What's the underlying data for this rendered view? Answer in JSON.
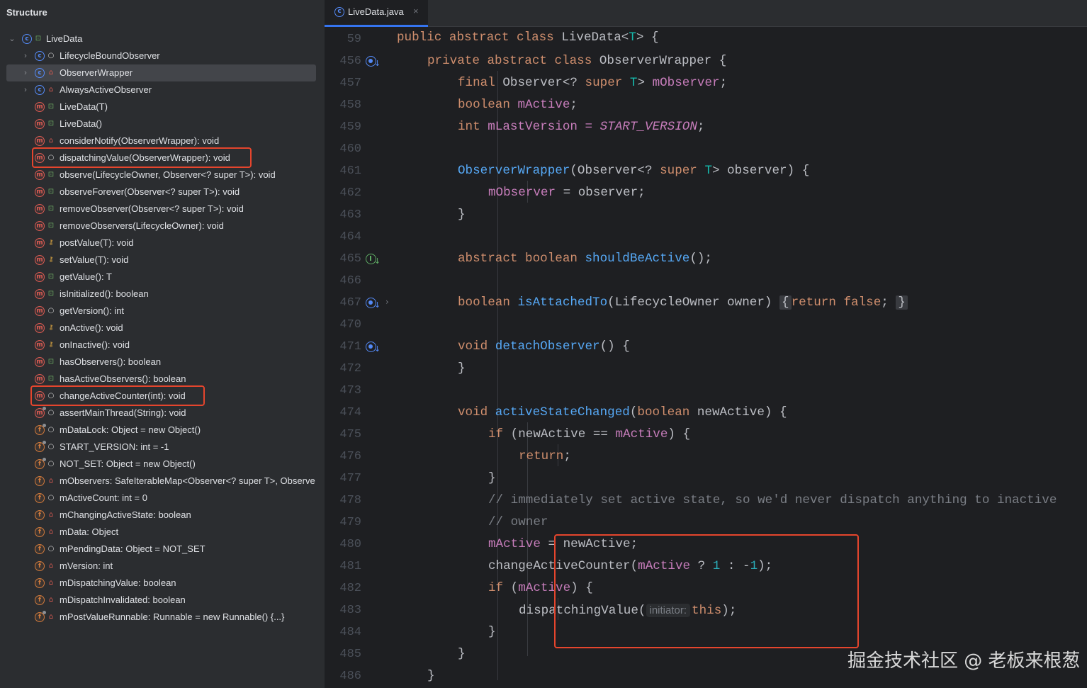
{
  "structure_panel": {
    "title": "Structure",
    "root": "LiveData",
    "items": [
      {
        "label": "LifecycleBoundObserver",
        "kind": "class",
        "vis": "package",
        "expandable": true
      },
      {
        "label": "ObserverWrapper",
        "kind": "class",
        "vis": "private",
        "expandable": true,
        "selected": true
      },
      {
        "label": "AlwaysActiveObserver",
        "kind": "class",
        "vis": "private",
        "expandable": true
      },
      {
        "label": "LiveData(T)",
        "kind": "method",
        "vis": "public"
      },
      {
        "label": "LiveData()",
        "kind": "method",
        "vis": "public"
      },
      {
        "label": "considerNotify(ObserverWrapper): void",
        "kind": "method",
        "vis": "private"
      },
      {
        "label": "dispatchingValue(ObserverWrapper): void",
        "kind": "method",
        "vis": "package",
        "highlighted": true
      },
      {
        "label": "observe(LifecycleOwner, Observer<? super T>): void",
        "kind": "method",
        "vis": "public"
      },
      {
        "label": "observeForever(Observer<? super T>): void",
        "kind": "method",
        "vis": "public"
      },
      {
        "label": "removeObserver(Observer<? super T>): void",
        "kind": "method",
        "vis": "public"
      },
      {
        "label": "removeObservers(LifecycleOwner): void",
        "kind": "method",
        "vis": "public"
      },
      {
        "label": "postValue(T): void",
        "kind": "method",
        "vis": "protected"
      },
      {
        "label": "setValue(T): void",
        "kind": "method",
        "vis": "protected"
      },
      {
        "label": "getValue(): T",
        "kind": "method",
        "vis": "public"
      },
      {
        "label": "isInitialized(): boolean",
        "kind": "method",
        "vis": "public"
      },
      {
        "label": "getVersion(): int",
        "kind": "method",
        "vis": "package"
      },
      {
        "label": "onActive(): void",
        "kind": "method",
        "vis": "protected"
      },
      {
        "label": "onInactive(): void",
        "kind": "method",
        "vis": "protected"
      },
      {
        "label": "hasObservers(): boolean",
        "kind": "method",
        "vis": "public"
      },
      {
        "label": "hasActiveObservers(): boolean",
        "kind": "method",
        "vis": "public"
      },
      {
        "label": "changeActiveCounter(int): void",
        "kind": "method",
        "vis": "package",
        "highlighted": true
      },
      {
        "label": "assertMainThread(String): void",
        "kind": "method",
        "vis": "package",
        "static": true
      },
      {
        "label": "mDataLock: Object = new Object()",
        "kind": "field",
        "vis": "package",
        "static": true
      },
      {
        "label": "START_VERSION: int = -1",
        "kind": "field",
        "vis": "package",
        "static": true
      },
      {
        "label": "NOT_SET: Object = new Object()",
        "kind": "field",
        "vis": "package",
        "static": true
      },
      {
        "label": "mObservers: SafeIterableMap<Observer<? super T>, Observe",
        "kind": "field",
        "vis": "private"
      },
      {
        "label": "mActiveCount: int = 0",
        "kind": "field",
        "vis": "package"
      },
      {
        "label": "mChangingActiveState: boolean",
        "kind": "field",
        "vis": "private"
      },
      {
        "label": "mData: Object",
        "kind": "field",
        "vis": "private"
      },
      {
        "label": "mPendingData: Object = NOT_SET",
        "kind": "field",
        "vis": "package"
      },
      {
        "label": "mVersion: int",
        "kind": "field",
        "vis": "private"
      },
      {
        "label": "mDispatchingValue: boolean",
        "kind": "field",
        "vis": "private"
      },
      {
        "label": "mDispatchInvalidated: boolean",
        "kind": "field",
        "vis": "private"
      },
      {
        "label": "mPostValueRunnable: Runnable = new Runnable() {...}",
        "kind": "field",
        "vis": "private",
        "static": true
      }
    ]
  },
  "editor": {
    "tab": {
      "label": "LiveData.java",
      "close": "×"
    },
    "lines": [
      {
        "no": "59",
        "gutter": null,
        "text": ""
      },
      {
        "no": "456",
        "gutter": "overridden",
        "text": ""
      },
      {
        "no": "457",
        "gutter": null,
        "text": ""
      },
      {
        "no": "458",
        "gutter": null,
        "text": ""
      },
      {
        "no": "459",
        "gutter": null,
        "text": ""
      },
      {
        "no": "460",
        "gutter": null,
        "text": ""
      },
      {
        "no": "461",
        "gutter": null,
        "text": ""
      },
      {
        "no": "462",
        "gutter": null,
        "text": ""
      },
      {
        "no": "463",
        "gutter": null,
        "text": ""
      },
      {
        "no": "464",
        "gutter": null,
        "text": ""
      },
      {
        "no": "465",
        "gutter": "implemented",
        "text": ""
      },
      {
        "no": "466",
        "gutter": null,
        "text": ""
      },
      {
        "no": "467",
        "gutter": "overridden",
        "text": ""
      },
      {
        "no": "470",
        "gutter": null,
        "text": ""
      },
      {
        "no": "471",
        "gutter": "overridden",
        "text": ""
      },
      {
        "no": "472",
        "gutter": null,
        "text": ""
      },
      {
        "no": "473",
        "gutter": null,
        "text": ""
      },
      {
        "no": "474",
        "gutter": null,
        "text": ""
      },
      {
        "no": "475",
        "gutter": null,
        "text": ""
      },
      {
        "no": "476",
        "gutter": null,
        "text": ""
      },
      {
        "no": "477",
        "gutter": null,
        "text": ""
      },
      {
        "no": "478",
        "gutter": null,
        "text": ""
      },
      {
        "no": "479",
        "gutter": null,
        "text": ""
      },
      {
        "no": "480",
        "gutter": null,
        "text": ""
      },
      {
        "no": "481",
        "gutter": null,
        "text": ""
      },
      {
        "no": "482",
        "gutter": null,
        "text": ""
      },
      {
        "no": "483",
        "gutter": null,
        "text": ""
      },
      {
        "no": "484",
        "gutter": null,
        "text": ""
      },
      {
        "no": "485",
        "gutter": null,
        "text": ""
      },
      {
        "no": "486",
        "gutter": null,
        "text": ""
      }
    ],
    "code": {
      "l59": [
        "public",
        "abstract",
        "class",
        "LiveData<",
        "T",
        "> {"
      ],
      "l456": [
        "private",
        "abstract",
        "class",
        "ObserverWrapper {"
      ],
      "l457": [
        "final",
        "Observer<?",
        "super",
        "T",
        ">",
        "mObserver",
        ";"
      ],
      "l458": [
        "boolean",
        "mActive",
        ";"
      ],
      "l459": [
        "int",
        "mLastVersion = ",
        "START_VERSION",
        ";"
      ],
      "l461": [
        "ObserverWrapper",
        "(Observer<?",
        "super",
        "T",
        "> observer) {"
      ],
      "l462": [
        "mObserver",
        " = observer;"
      ],
      "l463": "}",
      "l465": [
        "abstract",
        "boolean",
        "shouldBeActive",
        "();"
      ],
      "l467": [
        "boolean",
        "isAttachedTo",
        "(LifecycleOwner owner)",
        "{",
        "return",
        "false",
        ";",
        "}"
      ],
      "l471": [
        "void",
        "detachObserver",
        "() {"
      ],
      "l472": "}",
      "l474": [
        "void",
        "activeStateChanged",
        "(",
        "boolean",
        " newActive) {"
      ],
      "l475": [
        "if",
        " (newActive == ",
        "mActive",
        ") {"
      ],
      "l476": [
        "return",
        ";"
      ],
      "l477": "}",
      "l478": "// immediately set active state, so we'd never dispatch anything to inactive",
      "l479": "// owner",
      "l480": [
        "mActive",
        " = newActive;"
      ],
      "l481": [
        "changeActiveCounter(",
        "mActive",
        " ? ",
        "1",
        " : -",
        "1",
        ");"
      ],
      "l482": [
        "if",
        " (",
        "mActive",
        ") {"
      ],
      "l483": [
        "dispatchingValue(",
        "initiator:",
        "this",
        ");"
      ],
      "l484": "}",
      "l485": "}",
      "l486": "}"
    }
  },
  "watermark": "掘金技术社区 @ 老板来根葱",
  "colors": {
    "highlight_box": "#e5452d",
    "keyword": "#cf8e6d",
    "field": "#c77dbb",
    "function": "#56a8f5",
    "number": "#2aacb8",
    "type_param": "#16baac"
  }
}
